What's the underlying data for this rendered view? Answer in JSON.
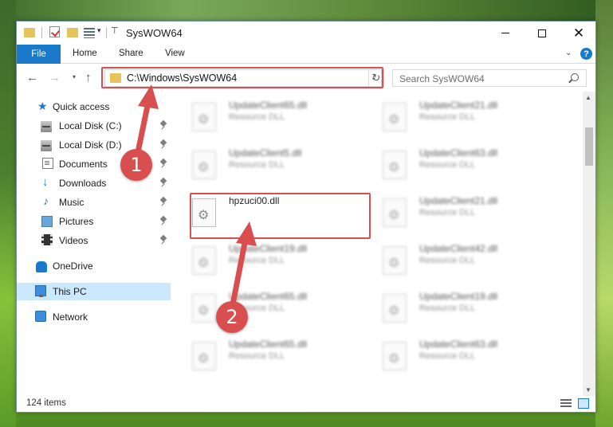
{
  "window": {
    "title": "SysWOW64"
  },
  "ribbon": {
    "file_tab": "File",
    "home_tab": "Home",
    "share_tab": "Share",
    "view_tab": "View",
    "help": "?"
  },
  "navigation": {
    "address": "C:\\Windows\\SysWOW64",
    "search_placeholder": "Search SysWOW64"
  },
  "sidebar": {
    "items": [
      {
        "label": "Quick access",
        "icon": "star-icon"
      },
      {
        "label": "Local Disk (C:)",
        "icon": "drive-icon",
        "pinned": true
      },
      {
        "label": "Local Disk (D:)",
        "icon": "drive-icon",
        "pinned": true
      },
      {
        "label": "Documents",
        "icon": "documents-icon",
        "pinned": true
      },
      {
        "label": "Downloads",
        "icon": "download-icon",
        "pinned": true
      },
      {
        "label": "Music",
        "icon": "music-icon",
        "pinned": true
      },
      {
        "label": "Pictures",
        "icon": "pictures-icon",
        "pinned": true
      },
      {
        "label": "Videos",
        "icon": "videos-icon",
        "pinned": true
      },
      {
        "label": "OneDrive",
        "icon": "cloud-icon"
      },
      {
        "label": "This PC",
        "icon": "computer-icon",
        "selected": true
      },
      {
        "label": "Network",
        "icon": "network-icon"
      }
    ]
  },
  "files": [
    {
      "name": "UpdateClient65.dll",
      "type": "Resource DLL"
    },
    {
      "name": "UpdateClient21.dll",
      "type": "Resource DLL"
    },
    {
      "name": "UpdateClient5.dll",
      "type": "Resource DLL"
    },
    {
      "name": "UpdateClient63.dll",
      "type": "Resource DLL"
    },
    {
      "name": "hpzuci00.dll",
      "type": "",
      "highlighted": true
    },
    {
      "name": "UpdateClient21.dll",
      "type": "Resource DLL"
    },
    {
      "name": "UpdateClient19.dll",
      "type": "Resource DLL"
    },
    {
      "name": "UpdateClient42.dll",
      "type": "Resource DLL"
    },
    {
      "name": "UpdateClient65.dll",
      "type": "Resource DLL"
    },
    {
      "name": "UpdateClient19.dll",
      "type": "Resource DLL"
    },
    {
      "name": "UpdateClient65.dll",
      "type": "Resource DLL"
    },
    {
      "name": "UpdateClient63.dll",
      "type": "Resource DLL"
    }
  ],
  "status": {
    "item_count": "124 items"
  },
  "callouts": {
    "step1": "1",
    "step2": "2"
  },
  "colors": {
    "accent": "#1979ca",
    "highlight": "#d94f4f",
    "selected": "#cce8ff"
  }
}
